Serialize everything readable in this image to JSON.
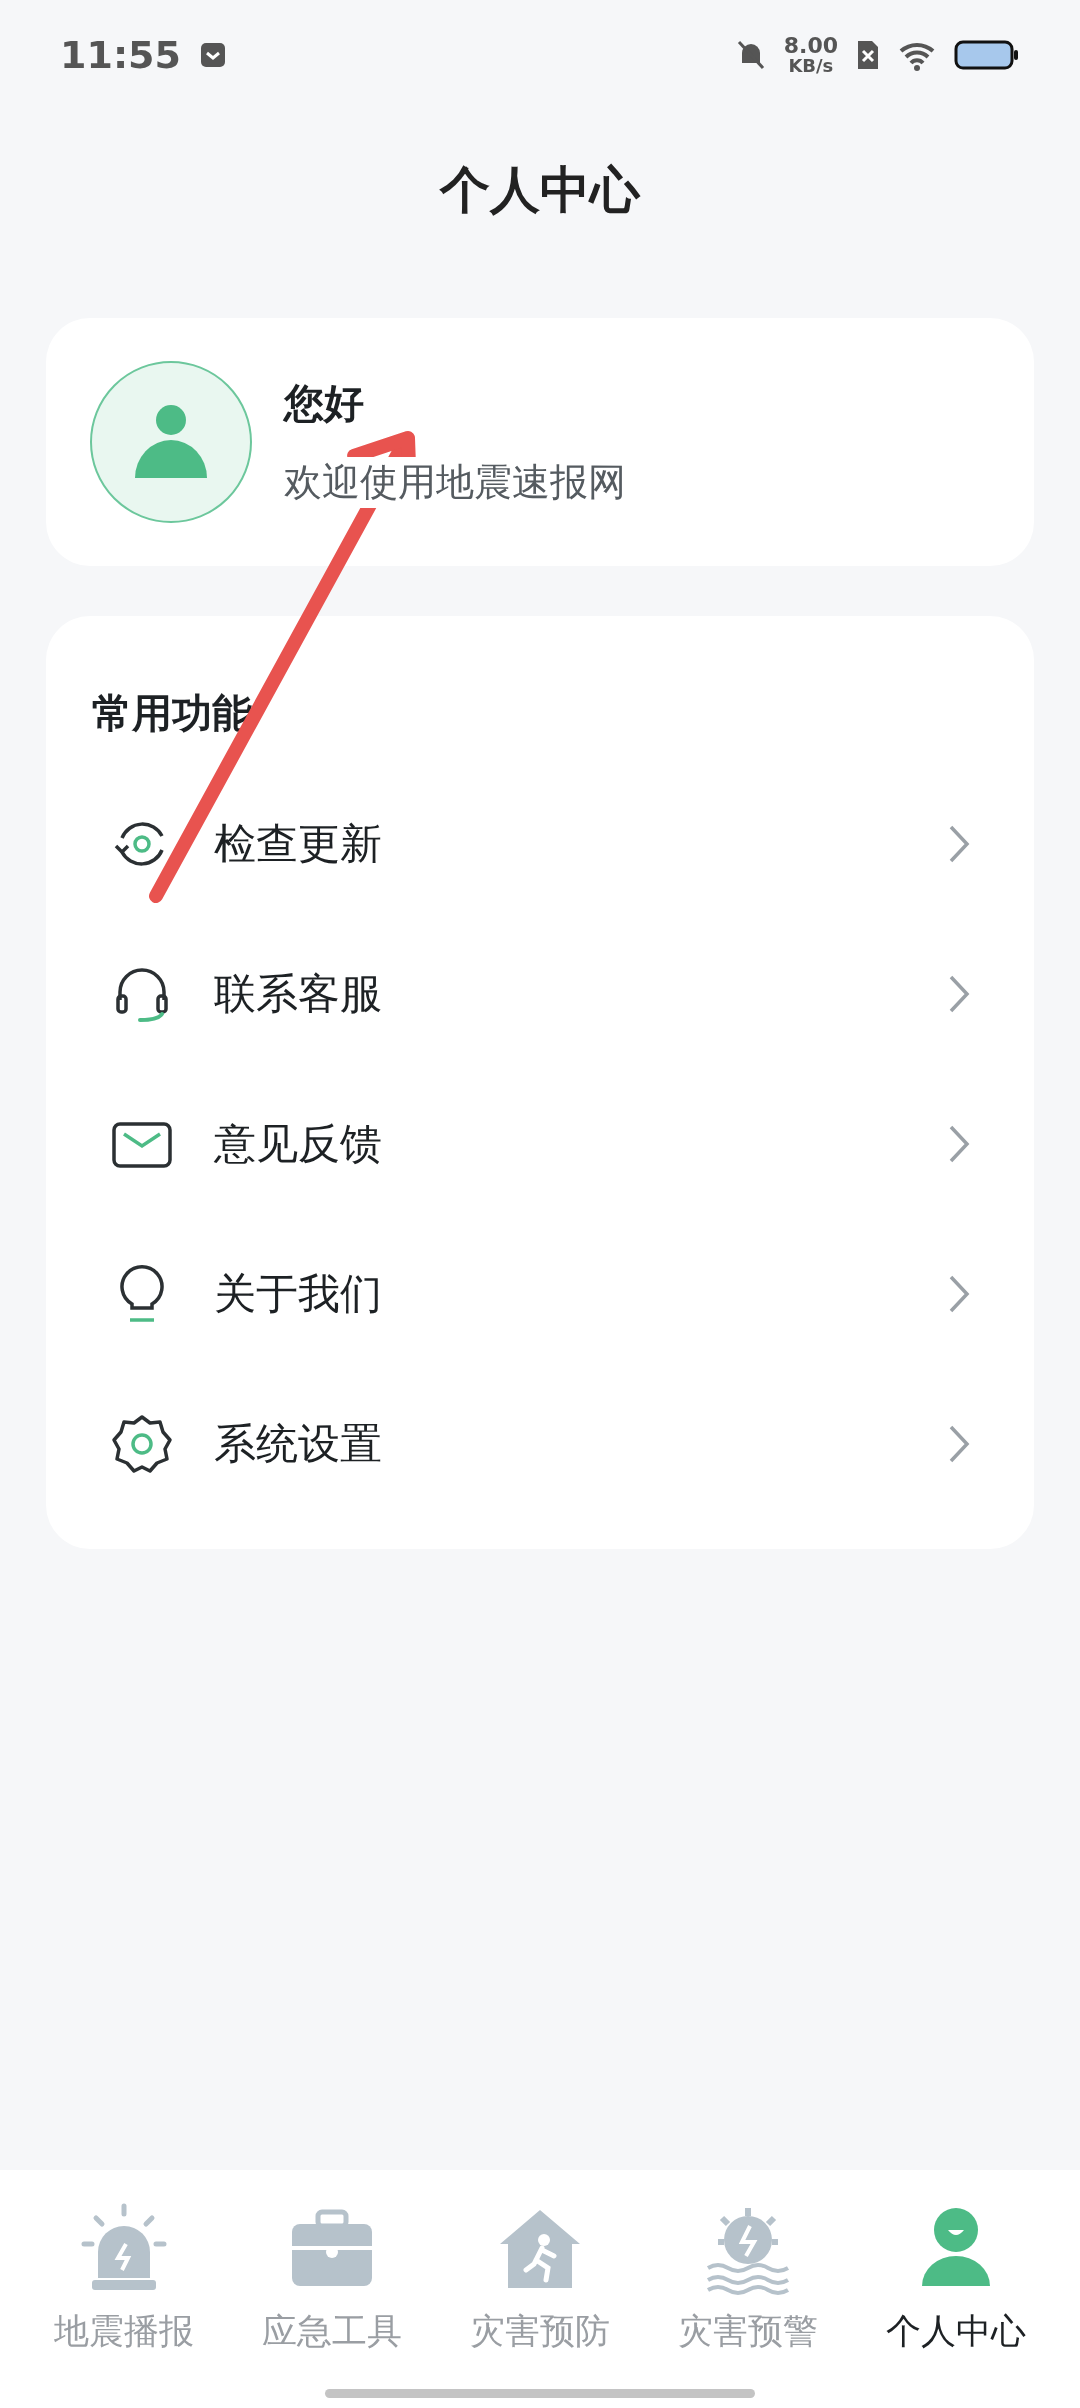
{
  "status_bar": {
    "time": "11:55",
    "net_speed": "8.00",
    "net_unit": "KB/s"
  },
  "header": {
    "title": "个人中心"
  },
  "profile": {
    "greeting": "您好",
    "subtitle": "欢迎使用地震速报网"
  },
  "functions": {
    "title": "常用功能",
    "items": [
      {
        "label": "检查更新",
        "kind": "update"
      },
      {
        "label": "联系客服",
        "kind": "service"
      },
      {
        "label": "意见反馈",
        "kind": "feedback"
      },
      {
        "label": "关于我们",
        "kind": "about"
      },
      {
        "label": "系统设置",
        "kind": "settings"
      }
    ]
  },
  "tabs": [
    {
      "label": "地震播报",
      "kind": "alarm",
      "selected": false
    },
    {
      "label": "应急工具",
      "kind": "toolbox",
      "selected": false
    },
    {
      "label": "灾害预防",
      "kind": "house",
      "selected": false
    },
    {
      "label": "灾害预警",
      "kind": "warning",
      "selected": false
    },
    {
      "label": "个人中心",
      "kind": "person",
      "selected": true
    }
  ],
  "annotation": {
    "kind": "arrow"
  }
}
